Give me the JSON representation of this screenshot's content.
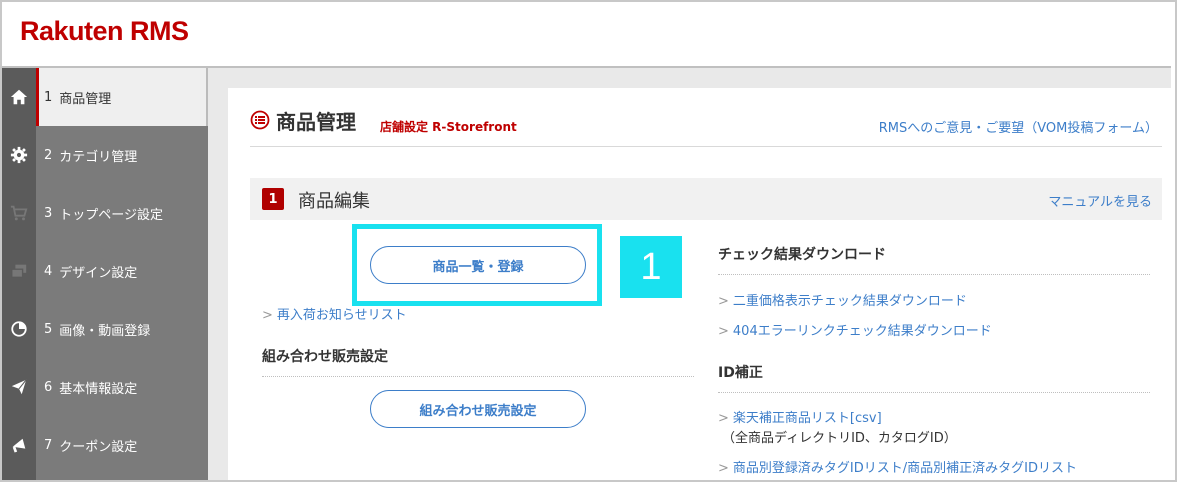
{
  "header": {
    "logo": "Rakuten RMS"
  },
  "sidebar": {
    "items": [
      {
        "num": "1",
        "label": "商品管理",
        "icon": "home-icon",
        "active": true
      },
      {
        "num": "2",
        "label": "カテゴリ管理",
        "icon": "gear-icon",
        "active": false
      },
      {
        "num": "3",
        "label": "トップページ設定",
        "icon": "cart-icon",
        "active": false
      },
      {
        "num": "4",
        "label": "デザイン設定",
        "icon": "windows-icon",
        "active": false
      },
      {
        "num": "5",
        "label": "画像・動画登録",
        "icon": "pie-icon",
        "active": false
      },
      {
        "num": "6",
        "label": "基本情報設定",
        "icon": "paper-plane-icon",
        "active": false
      },
      {
        "num": "7",
        "label": "クーポン設定",
        "icon": "megaphone-icon",
        "active": false
      }
    ]
  },
  "main": {
    "title": "商品管理",
    "subtitle": "店舗設定 R-Storefront",
    "feedback_link": "RMSへのご意見・ご要望（VOM投稿フォーム）",
    "section": {
      "badge": "1",
      "title": "商品編集",
      "manual_link": "マニュアルを見る"
    },
    "left": {
      "primary_button": "商品一覧・登録",
      "callout_number": "1",
      "restock_link": "再入荷お知らせリスト",
      "combo_heading": "組み合わせ販売設定",
      "combo_button": "組み合わせ販売設定"
    },
    "right": {
      "check_heading": "チェック結果ダウンロード",
      "check_links": [
        "二重価格表示チェック結果ダウンロード",
        "404エラーリンクチェック結果ダウンロード"
      ],
      "id_heading": "ID補正",
      "id_link_1": "楽天補正商品リスト[csv]",
      "id_note": "（全商品ディレクトリID、カタログID）",
      "id_link_2": "商品別登録済みタグIDリスト/商品別補正済みタグIDリスト"
    }
  },
  "colors": {
    "brand": "#bf0000",
    "link": "#3d7ec9",
    "highlight": "#19e1ef",
    "sidebar": "#7b7b7b"
  }
}
